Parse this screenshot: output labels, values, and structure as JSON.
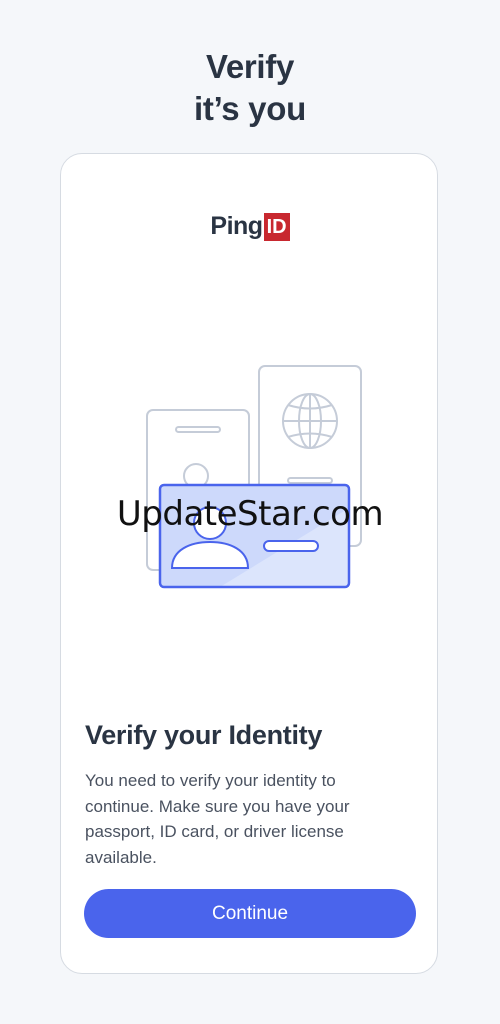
{
  "header": {
    "title_line1": "Verify",
    "title_line2": "it’s you"
  },
  "logo": {
    "text": "Ping",
    "badge": "ID"
  },
  "watermark": "UpdateStar.com",
  "main": {
    "heading": "Verify your Identity",
    "description": "You need to verify your identity to continue. Make sure you have your passport, ID card, or driver license available.",
    "continue_label": "Continue"
  },
  "colors": {
    "background": "#f5f7fa",
    "card": "#ffffff",
    "primary_button": "#4a64ec",
    "logo_badge": "#c8282f",
    "heading_text": "#2a3443",
    "illustration_accent": "#4a64ec"
  }
}
